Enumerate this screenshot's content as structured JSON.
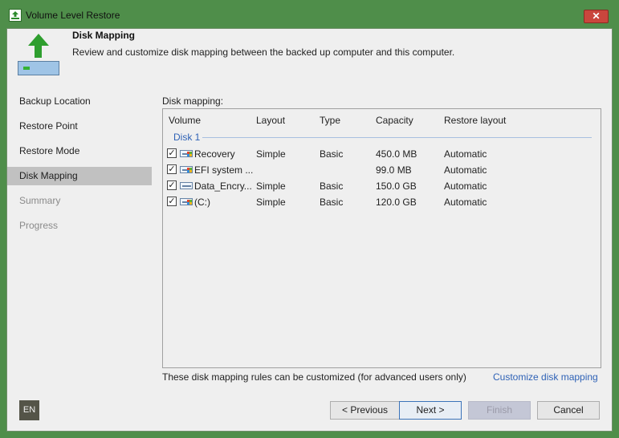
{
  "window": {
    "title": "Volume Level Restore",
    "close_label": "✕",
    "accent": "#4f8e4a"
  },
  "header": {
    "title": "Disk Mapping",
    "description": "Review and customize disk mapping between the backed up computer and this computer."
  },
  "sidebar": {
    "items": [
      {
        "label": "Backup Location",
        "state": "normal"
      },
      {
        "label": "Restore Point",
        "state": "normal"
      },
      {
        "label": "Restore Mode",
        "state": "normal"
      },
      {
        "label": "Disk Mapping",
        "state": "active"
      },
      {
        "label": "Summary",
        "state": "disabled"
      },
      {
        "label": "Progress",
        "state": "disabled"
      }
    ]
  },
  "mapping": {
    "label": "Disk mapping:",
    "columns": [
      "Volume",
      "Layout",
      "Type",
      "Capacity",
      "Restore layout"
    ],
    "group": "Disk 1",
    "rows": [
      {
        "checked": true,
        "volume": "Recovery",
        "layout": "Simple",
        "type": "Basic",
        "capacity": "450.0 MB",
        "restore_layout": "Automatic",
        "icon": "windows-volume-icon"
      },
      {
        "checked": true,
        "volume": "EFI system ...",
        "layout": "",
        "type": "",
        "capacity": "99.0 MB",
        "restore_layout": "Automatic",
        "icon": "windows-volume-icon"
      },
      {
        "checked": true,
        "volume": "Data_Encry...",
        "layout": "Simple",
        "type": "Basic",
        "capacity": "150.0 GB",
        "restore_layout": "Automatic",
        "icon": "drive-volume-icon"
      },
      {
        "checked": true,
        "volume": "(C:)",
        "layout": "Simple",
        "type": "Basic",
        "capacity": "120.0 GB",
        "restore_layout": "Automatic",
        "icon": "windows-volume-icon"
      }
    ],
    "note": "These disk mapping rules can be customized (for advanced users only)",
    "customize_link": "Customize disk mapping"
  },
  "footer": {
    "language": "EN",
    "previous_label": "< Previous",
    "next_label": "Next >",
    "finish_label": "Finish",
    "cancel_label": "Cancel"
  },
  "colors": {
    "link": "#2f62b6",
    "active_sidebar": "#c1c1c1",
    "close": "#c9463d"
  }
}
